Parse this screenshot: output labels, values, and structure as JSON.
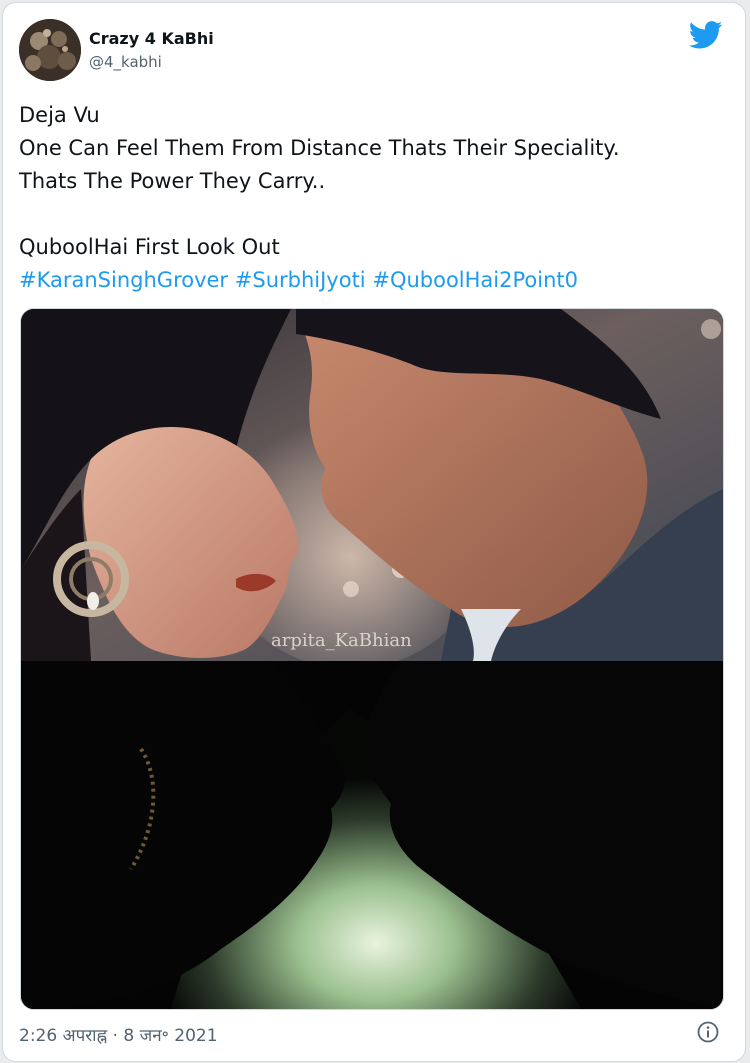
{
  "author": {
    "display_name": "Crazy 4 KaBhi",
    "handle": "@4_kabhi",
    "avatar_icon": "profile-avatar"
  },
  "tweet": {
    "lines": [
      "Deja Vu",
      "One Can Feel Them From Distance Thats Their Speciality.",
      "Thats The Power They Carry..",
      "",
      "QuboolHai First Look Out"
    ],
    "hashtags": [
      "#KaranSinghGrover",
      "#SurbhiJyoti",
      "#QuboolHai2Point0"
    ]
  },
  "media": {
    "watermark": "arpita_KaBhian"
  },
  "meta": {
    "timestamp": "2:26 अपराह्न · 8 जन॰ 2021"
  },
  "icons": {
    "brand": "twitter-bird-icon",
    "info": "info-icon"
  },
  "colors": {
    "accent": "#1d9bf0",
    "muted": "#536471"
  }
}
